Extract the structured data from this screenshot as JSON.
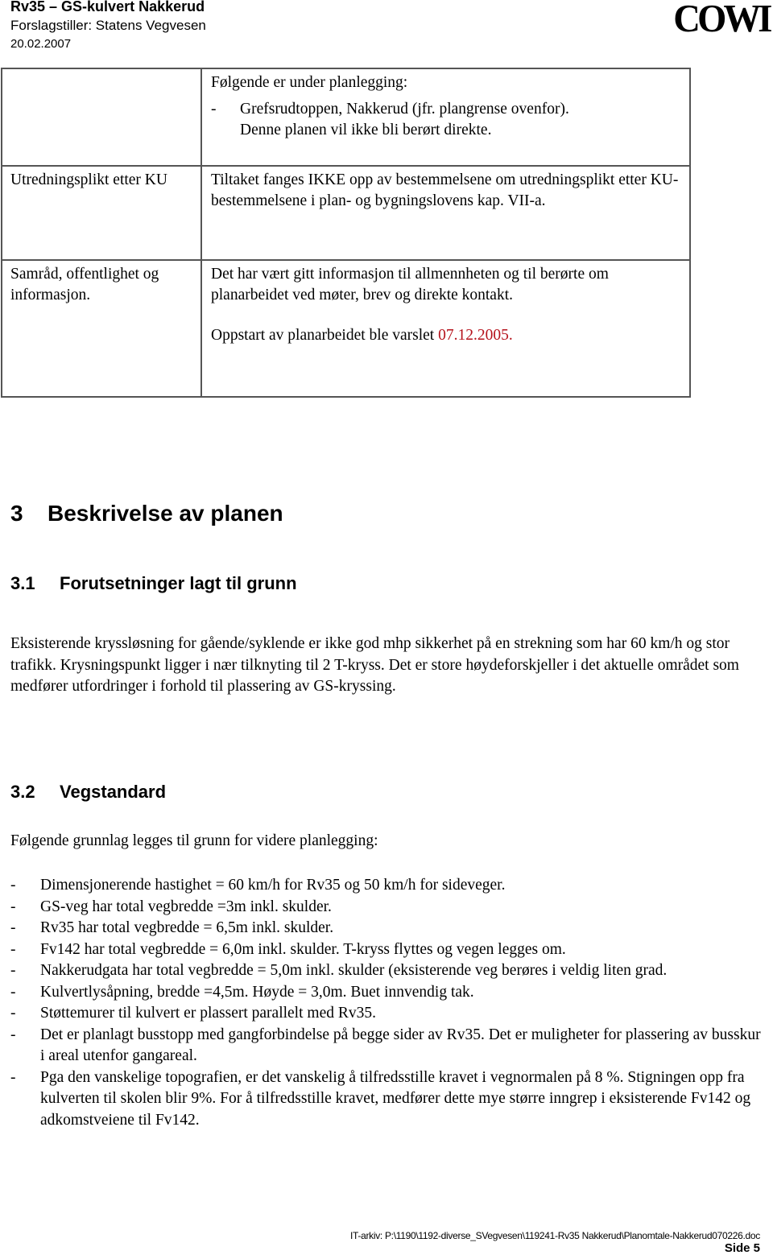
{
  "header": {
    "title": "Rv35 – GS-kulvert Nakkerud",
    "subtitle": "Forslagstiller: Statens Vegvesen",
    "date": "20.02.2007",
    "logo": "COWI"
  },
  "table": {
    "rows": [
      {
        "label": "",
        "intro": "Følgende er under planlegging:",
        "dash_item_line1": "Grefsrudtoppen, Nakkerud (jfr. plangrense ovenfor).",
        "dash_item_line2": "Denne planen vil ikke bli berørt direkte."
      },
      {
        "label": "Utredningsplikt etter KU",
        "text": "Tiltaket fanges IKKE opp av bestemmelsene om utredningsplikt etter KU-bestemmelsene i plan- og bygningslovens kap. VII-a."
      },
      {
        "label": "Samråd, offentlighet og informasjon.",
        "text": "Det har vært gitt informasjon til allmennheten og til berørte om planarbeidet ved møter, brev og direkte kontakt.",
        "notice_prefix": "Oppstart av planarbeidet ble varslet ",
        "notice_date": "07.12.2005.",
        "notice_date_color": "#b5121b"
      }
    ]
  },
  "section3": {
    "number": "3",
    "title": "Beskrivelse av planen",
    "sub1": {
      "number": "3.1",
      "title": "Forutsetninger lagt til grunn",
      "body": "Eksisterende kryssløsning for gående/syklende er ikke god mhp sikkerhet på en strekning som har 60 km/h og stor trafikk. Krysningspunkt ligger i nær tilknyting til 2 T-kryss. Det er store høydeforskjeller i det aktuelle området som medfører utfordringer i forhold til plassering av GS-kryssing."
    },
    "sub2": {
      "number": "3.2",
      "title": "Vegstandard",
      "intro": "Følgende grunnlag legges til grunn for videre planlegging:",
      "items": [
        "Dimensjonerende hastighet = 60 km/h for Rv35 og 50 km/h for sideveger.",
        "GS-veg har total vegbredde =3m inkl. skulder.",
        "Rv35 har total vegbredde = 6,5m inkl. skulder.",
        "Fv142 har total vegbredde = 6,0m inkl. skulder. T-kryss flyttes og vegen legges om.",
        "Nakkerudgata har total vegbredde = 5,0m inkl. skulder (eksisterende veg berøres i veldig liten grad.",
        "Kulvertlysåpning, bredde =4,5m. Høyde = 3,0m. Buet innvendig tak.",
        "Støttemurer til kulvert er plassert parallelt med Rv35.",
        "Det er planlagt busstopp med gangforbindelse på begge sider av Rv35. Det er muligheter for plassering av busskur i areal utenfor gangareal.",
        "Pga den vanskelige topografien, er det vanskelig å tilfredsstille kravet i vegnormalen på 8 %. Stigningen opp fra kulverten til skolen blir 9%. For å tilfredsstille kravet, medfører dette mye større inngrep i eksisterende Fv142 og adkomstveiene til Fv142."
      ],
      "dash": "-"
    }
  },
  "footer": {
    "path": "IT-arkiv: P:\\1190\\1192-diverse_SVegvesen\\119241-Rv35 Nakkerud\\Planomtale-Nakkerud070226.doc",
    "page": "Side 5"
  }
}
